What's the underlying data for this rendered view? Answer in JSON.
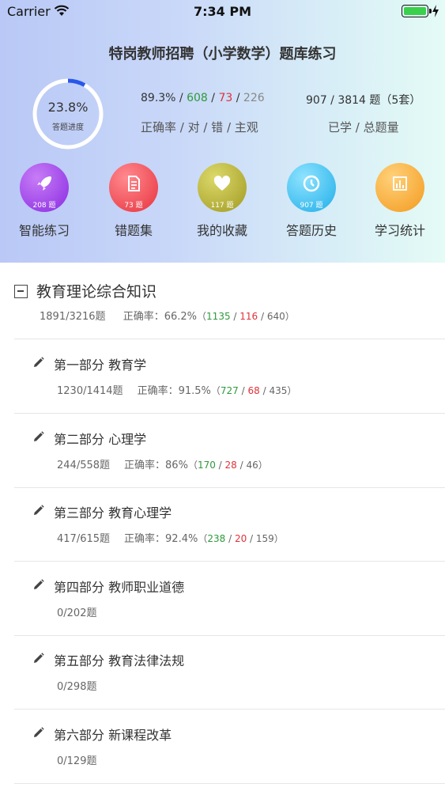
{
  "status_bar": {
    "carrier": "Carrier",
    "time": "7:34 PM"
  },
  "header": {
    "title": "特岗教师招聘（小学数学）题库练习",
    "progress": {
      "value_text": "23.8%",
      "value": 0.238,
      "label": "答题进度"
    },
    "accuracy": {
      "rate": "89.3%",
      "correct": "608",
      "wrong": "73",
      "subjective": "226",
      "label": "正确率 / 对 / 错 / 主观"
    },
    "studied": {
      "value": "907 / 3814 题（5套）",
      "label": "已学 / 总题量"
    }
  },
  "features": [
    {
      "label": "智能练习",
      "badge": "208 题",
      "icon": "rocket-icon",
      "color": "#9b3be8"
    },
    {
      "label": "错题集",
      "badge": "73 题",
      "icon": "document-icon",
      "color": "#f0454f"
    },
    {
      "label": "我的收藏",
      "badge": "117 题",
      "icon": "heart-icon",
      "color": "#a8a52a"
    },
    {
      "label": "答题历史",
      "badge": "907 题",
      "icon": "history-icon",
      "color": "#2ab8ee"
    },
    {
      "label": "学习统计",
      "badge": "",
      "icon": "bar-chart-icon",
      "color": "#f5a22a"
    }
  ],
  "section": {
    "title": "教育理论综合知识",
    "progress": "1891/3216题",
    "accuracy_label": "正确率：",
    "accuracy": "66.2%",
    "correct": "1135",
    "wrong": "116",
    "subjective": "640"
  },
  "items": [
    {
      "name": "第一部分 教育学",
      "progress": "1230/1414题",
      "has_accuracy": true,
      "accuracy_label": "正确率：",
      "accuracy": "91.5%",
      "correct": "727",
      "wrong": "68",
      "subjective": "435"
    },
    {
      "name": "第二部分 心理学",
      "progress": "244/558题",
      "has_accuracy": true,
      "accuracy_label": "正确率：",
      "accuracy": "86%",
      "correct": "170",
      "wrong": "28",
      "subjective": "46"
    },
    {
      "name": "第三部分 教育心理学",
      "progress": "417/615题",
      "has_accuracy": true,
      "accuracy_label": "正确率：",
      "accuracy": "92.4%",
      "correct": "238",
      "wrong": "20",
      "subjective": "159"
    },
    {
      "name": "第四部分 教师职业道德",
      "progress": "0/202题",
      "has_accuracy": false
    },
    {
      "name": "第五部分 教育法律法规",
      "progress": "0/298题",
      "has_accuracy": false
    },
    {
      "name": "第六部分 新课程改革",
      "progress": "0/129题",
      "has_accuracy": false
    }
  ],
  "colors": {
    "accent_blue": "#2957e8",
    "correct_green": "#2e9a3a",
    "wrong_red": "#e0313a"
  }
}
